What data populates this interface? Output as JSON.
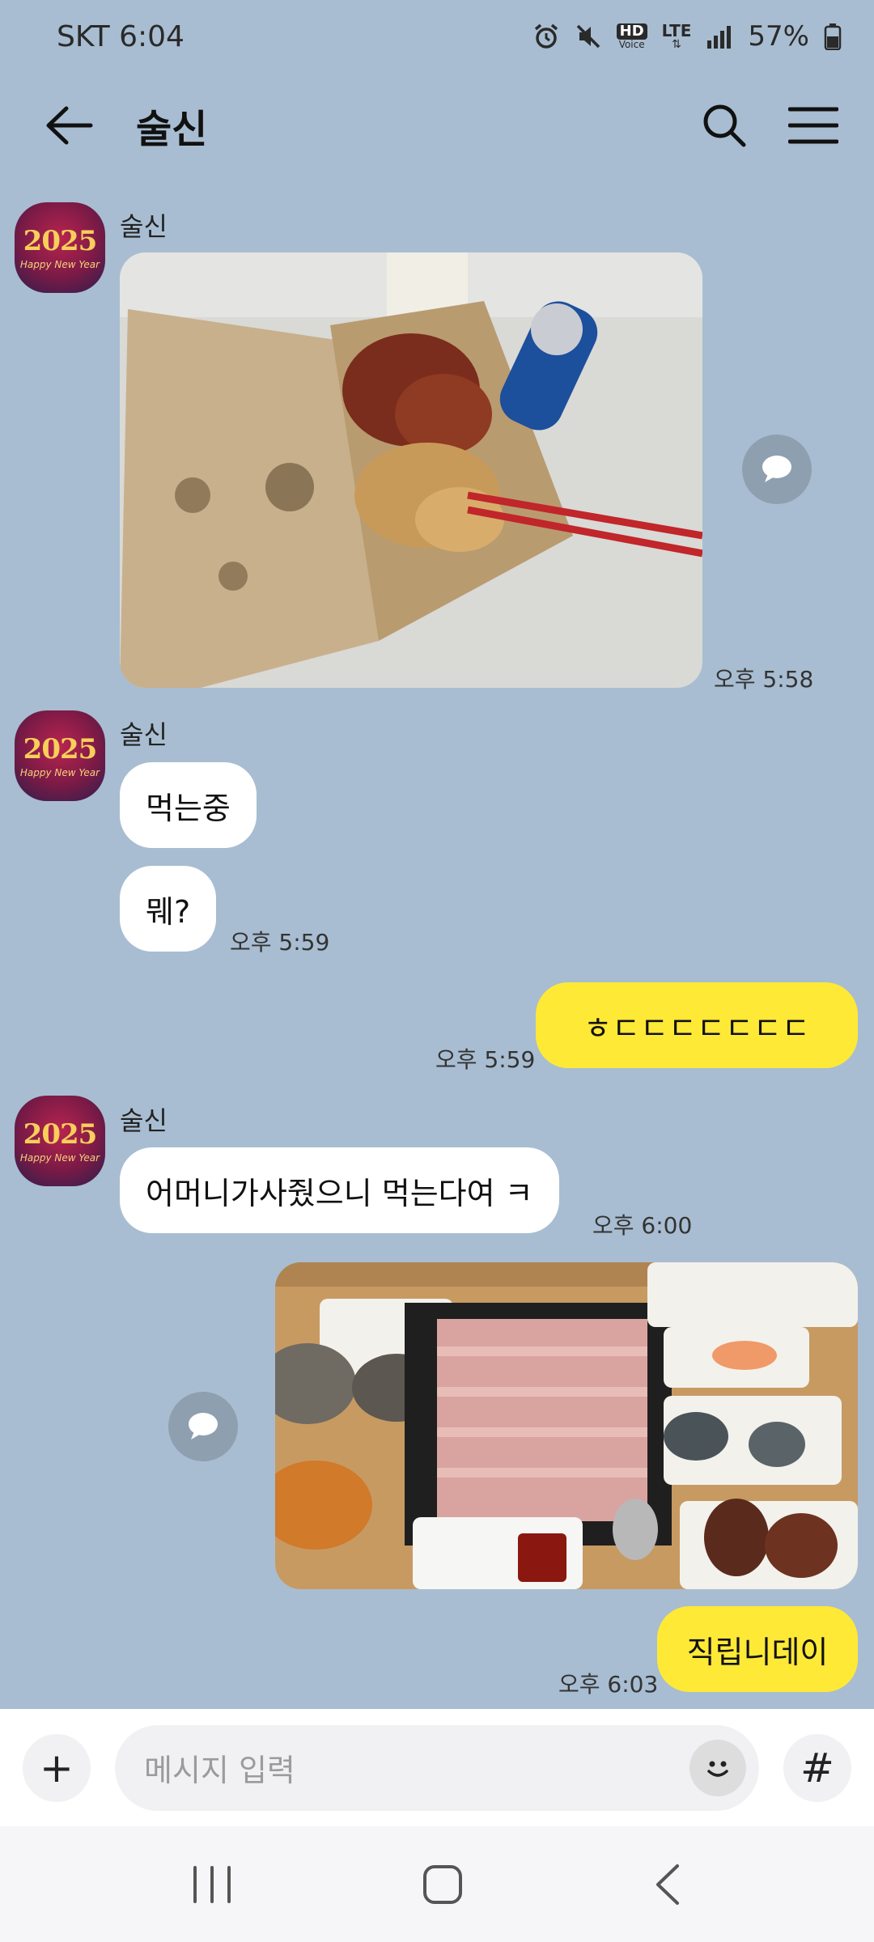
{
  "status": {
    "carrier_time": "SKT 6:04",
    "hd_label": "HD",
    "voice_label": "Voice",
    "lte_label": "LTE",
    "battery": "57%"
  },
  "header": {
    "title": "술신"
  },
  "avatar": {
    "year": "2025",
    "caption": "Happy New Year"
  },
  "messages": [
    {
      "sender": "술신",
      "type": "photo",
      "time": "오후 5:58"
    },
    {
      "sender": "술신",
      "type": "text",
      "text": "먹는중"
    },
    {
      "type": "text",
      "text": "뭬?",
      "time": "오후 5:59"
    },
    {
      "type": "text",
      "mine": true,
      "text": "ㅎㄷㄷㄷㄷㄷㄷㄷ",
      "time": "오후 5:59"
    },
    {
      "sender": "술신",
      "type": "text",
      "text": "어머니가사줬으니 먹는다여 ㅋ",
      "time": "오후 6:00"
    },
    {
      "type": "photo",
      "mine": true
    },
    {
      "type": "text",
      "mine": true,
      "text": "직립니데이",
      "time": "오후 6:03"
    }
  ],
  "input": {
    "placeholder": "메시지 입력",
    "hash_label": "#",
    "plus_label": "+"
  },
  "colors": {
    "background": "#a8bdd1",
    "my_bubble": "#fee937",
    "other_bubble": "#ffffff"
  }
}
